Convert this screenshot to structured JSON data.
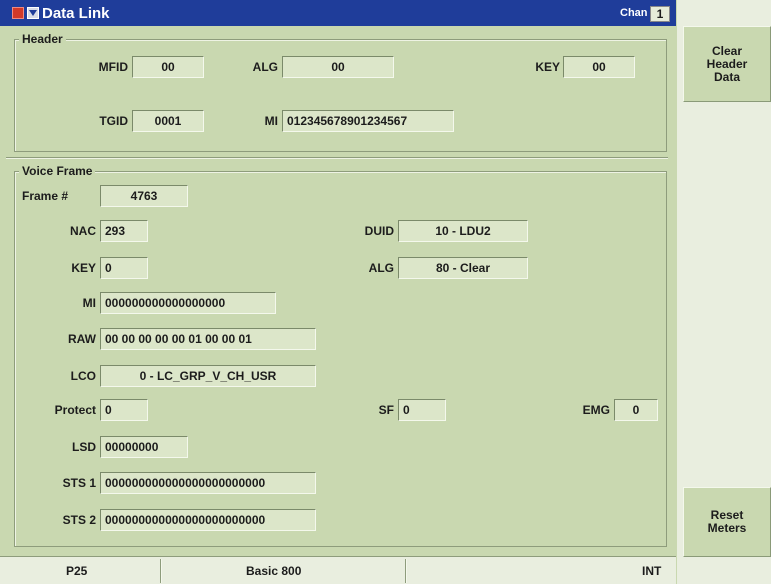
{
  "window": {
    "title": "Data Link",
    "chan_label": "Chan",
    "chan_value": "1"
  },
  "header": {
    "legend": "Header",
    "mfid": {
      "label": "MFID",
      "value": "00"
    },
    "alg": {
      "label": "ALG",
      "value": "00"
    },
    "key": {
      "label": "KEY",
      "value": "00"
    },
    "tgid": {
      "label": "TGID",
      "value": "0001"
    },
    "mi": {
      "label": "MI",
      "value": "012345678901234567"
    }
  },
  "voice_frame": {
    "legend": "Voice Frame",
    "frame_num": {
      "label": "Frame #",
      "value": "4763"
    },
    "nac": {
      "label": "NAC",
      "value": "293"
    },
    "duid": {
      "label": "DUID",
      "value": "10 - LDU2"
    },
    "key": {
      "label": "KEY",
      "value": "0"
    },
    "alg": {
      "label": "ALG",
      "value": "80 - Clear"
    },
    "mi": {
      "label": "MI",
      "value": "000000000000000000"
    },
    "raw": {
      "label": "RAW",
      "value": "00 00 00 00 00 01 00 00 01"
    },
    "lco": {
      "label": "LCO",
      "value": "0 - LC_GRP_V_CH_USR"
    },
    "protect": {
      "label": "Protect",
      "value": "0"
    },
    "sf": {
      "label": "SF",
      "value": "0"
    },
    "emg": {
      "label": "EMG",
      "value": "0"
    },
    "lsd": {
      "label": "LSD",
      "value": "00000000"
    },
    "sts1": {
      "label": "STS 1",
      "value": "000000000000000000000000"
    },
    "sts2": {
      "label": "STS 2",
      "value": "000000000000000000000000"
    }
  },
  "side": {
    "clear_header": "Clear\nHeader\nData",
    "reset_meters": "Reset\nMeters"
  },
  "status": {
    "mode": "P25",
    "system": "Basic 800",
    "ref": "INT"
  }
}
